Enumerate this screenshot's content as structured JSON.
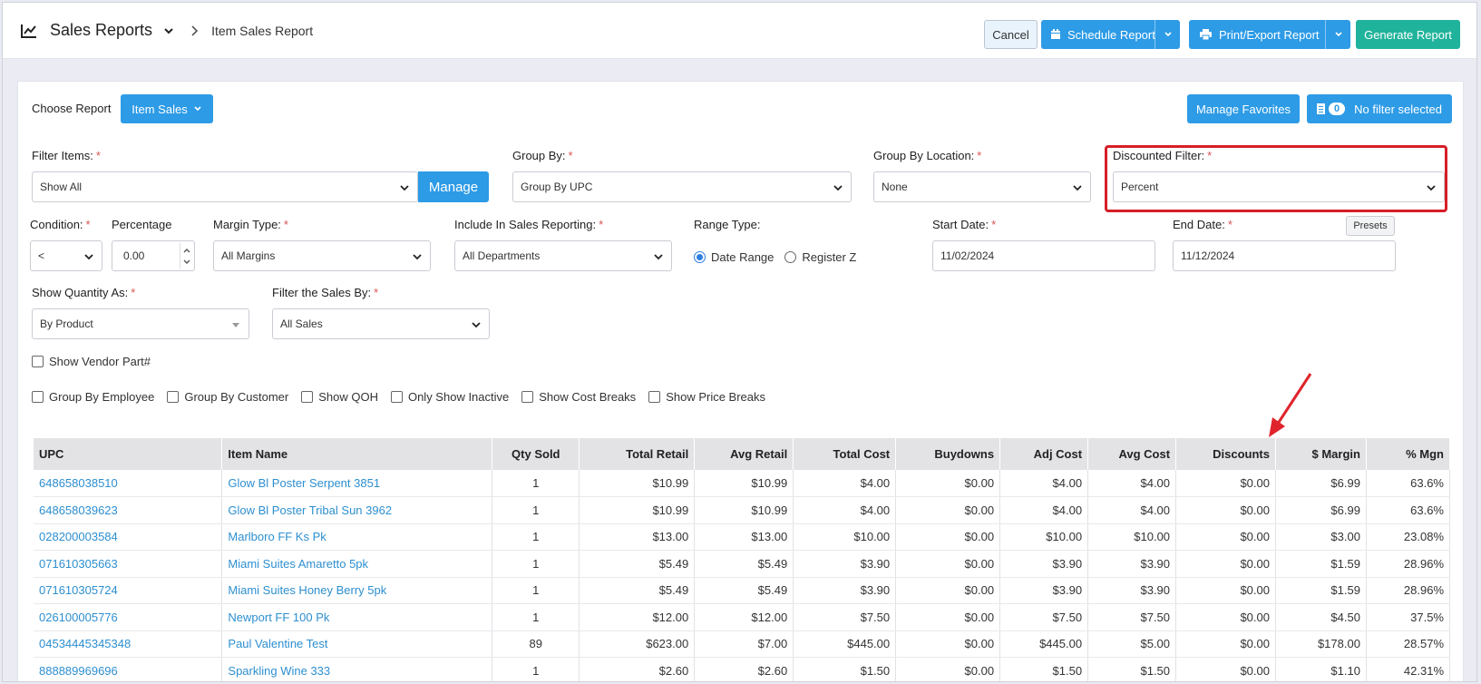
{
  "header": {
    "title": "Sales Reports",
    "breadcrumb": "Item Sales Report",
    "cancel_label": "Cancel",
    "schedule_label": "Schedule Report",
    "print_label": "Print/Export Report",
    "generate_label": "Generate Report"
  },
  "report": {
    "choose_label": "Choose Report",
    "dropdown_label": "Item Sales",
    "manage_favorites_label": "Manage Favorites",
    "filter_count": "0",
    "filter_status": "No filter selected"
  },
  "filters": {
    "filter_items_label": "Filter Items:",
    "filter_items_value": "Show All",
    "manage_label": "Manage",
    "group_by_label": "Group By:",
    "group_by_value": "Group By UPC",
    "group_by_location_label": "Group By Location:",
    "group_by_location_value": "None",
    "discounted_filter_label": "Discounted Filter:",
    "discounted_filter_value": "Percent",
    "condition_label": "Condition:",
    "condition_value": "<",
    "percentage_label": "Percentage",
    "percentage_value": "0.00",
    "margin_type_label": "Margin Type:",
    "margin_type_value": "All Margins",
    "include_label": "Include In Sales Reporting:",
    "include_value": "All Departments",
    "range_type_label": "Range Type:",
    "range_date": "Date Range",
    "range_z": "Register Z",
    "start_date_label": "Start Date:",
    "start_date_value": "11/02/2024",
    "end_date_label": "End Date:",
    "end_date_value": "11/12/2024",
    "presets_label": "Presets",
    "show_qty_label": "Show Quantity As:",
    "show_qty_value": "By Product",
    "filter_sales_label": "Filter the Sales By:",
    "filter_sales_value": "All Sales",
    "show_vendor_part": "Show Vendor Part#",
    "checkboxes": [
      "Group By Employee",
      "Group By Customer",
      "Show QOH",
      "Only Show Inactive",
      "Show Cost Breaks",
      "Show Price Breaks"
    ]
  },
  "table": {
    "headers": [
      "UPC",
      "Item Name",
      "Qty Sold",
      "Total Retail",
      "Avg Retail",
      "Total Cost",
      "Buydowns",
      "Adj Cost",
      "Avg Cost",
      "Discounts",
      "$ Margin",
      "% Mgn"
    ],
    "rows": [
      [
        "648658038510",
        "Glow Bl Poster Serpent 3851",
        "1",
        "$10.99",
        "$10.99",
        "$4.00",
        "$0.00",
        "$4.00",
        "$4.00",
        "$0.00",
        "$6.99",
        "63.6%"
      ],
      [
        "648658039623",
        "Glow Bl Poster Tribal Sun 3962",
        "1",
        "$10.99",
        "$10.99",
        "$4.00",
        "$0.00",
        "$4.00",
        "$4.00",
        "$0.00",
        "$6.99",
        "63.6%"
      ],
      [
        "028200003584",
        "Marlboro FF Ks Pk",
        "1",
        "$13.00",
        "$13.00",
        "$10.00",
        "$0.00",
        "$10.00",
        "$10.00",
        "$0.00",
        "$3.00",
        "23.08%"
      ],
      [
        "071610305663",
        "Miami Suites Amaretto 5pk",
        "1",
        "$5.49",
        "$5.49",
        "$3.90",
        "$0.00",
        "$3.90",
        "$3.90",
        "$0.00",
        "$1.59",
        "28.96%"
      ],
      [
        "071610305724",
        "Miami Suites Honey Berry 5pk",
        "1",
        "$5.49",
        "$5.49",
        "$3.90",
        "$0.00",
        "$3.90",
        "$3.90",
        "$0.00",
        "$1.59",
        "28.96%"
      ],
      [
        "026100005776",
        "Newport FF 100 Pk",
        "1",
        "$12.00",
        "$12.00",
        "$7.50",
        "$0.00",
        "$7.50",
        "$7.50",
        "$0.00",
        "$4.50",
        "37.5%"
      ],
      [
        "04534445345348",
        "Paul Valentine Test",
        "89",
        "$623.00",
        "$7.00",
        "$445.00",
        "$0.00",
        "$445.00",
        "$5.00",
        "$0.00",
        "$178.00",
        "28.57%"
      ],
      [
        "888889969696",
        "Sparkling Wine 333",
        "1",
        "$2.60",
        "$2.60",
        "$1.50",
        "$0.00",
        "$1.50",
        "$1.50",
        "$0.00",
        "$1.10",
        "42.31%"
      ]
    ]
  },
  "colors": {
    "primary": "#2d9be6",
    "success": "#20b39b",
    "highlight": "#d61f27"
  }
}
